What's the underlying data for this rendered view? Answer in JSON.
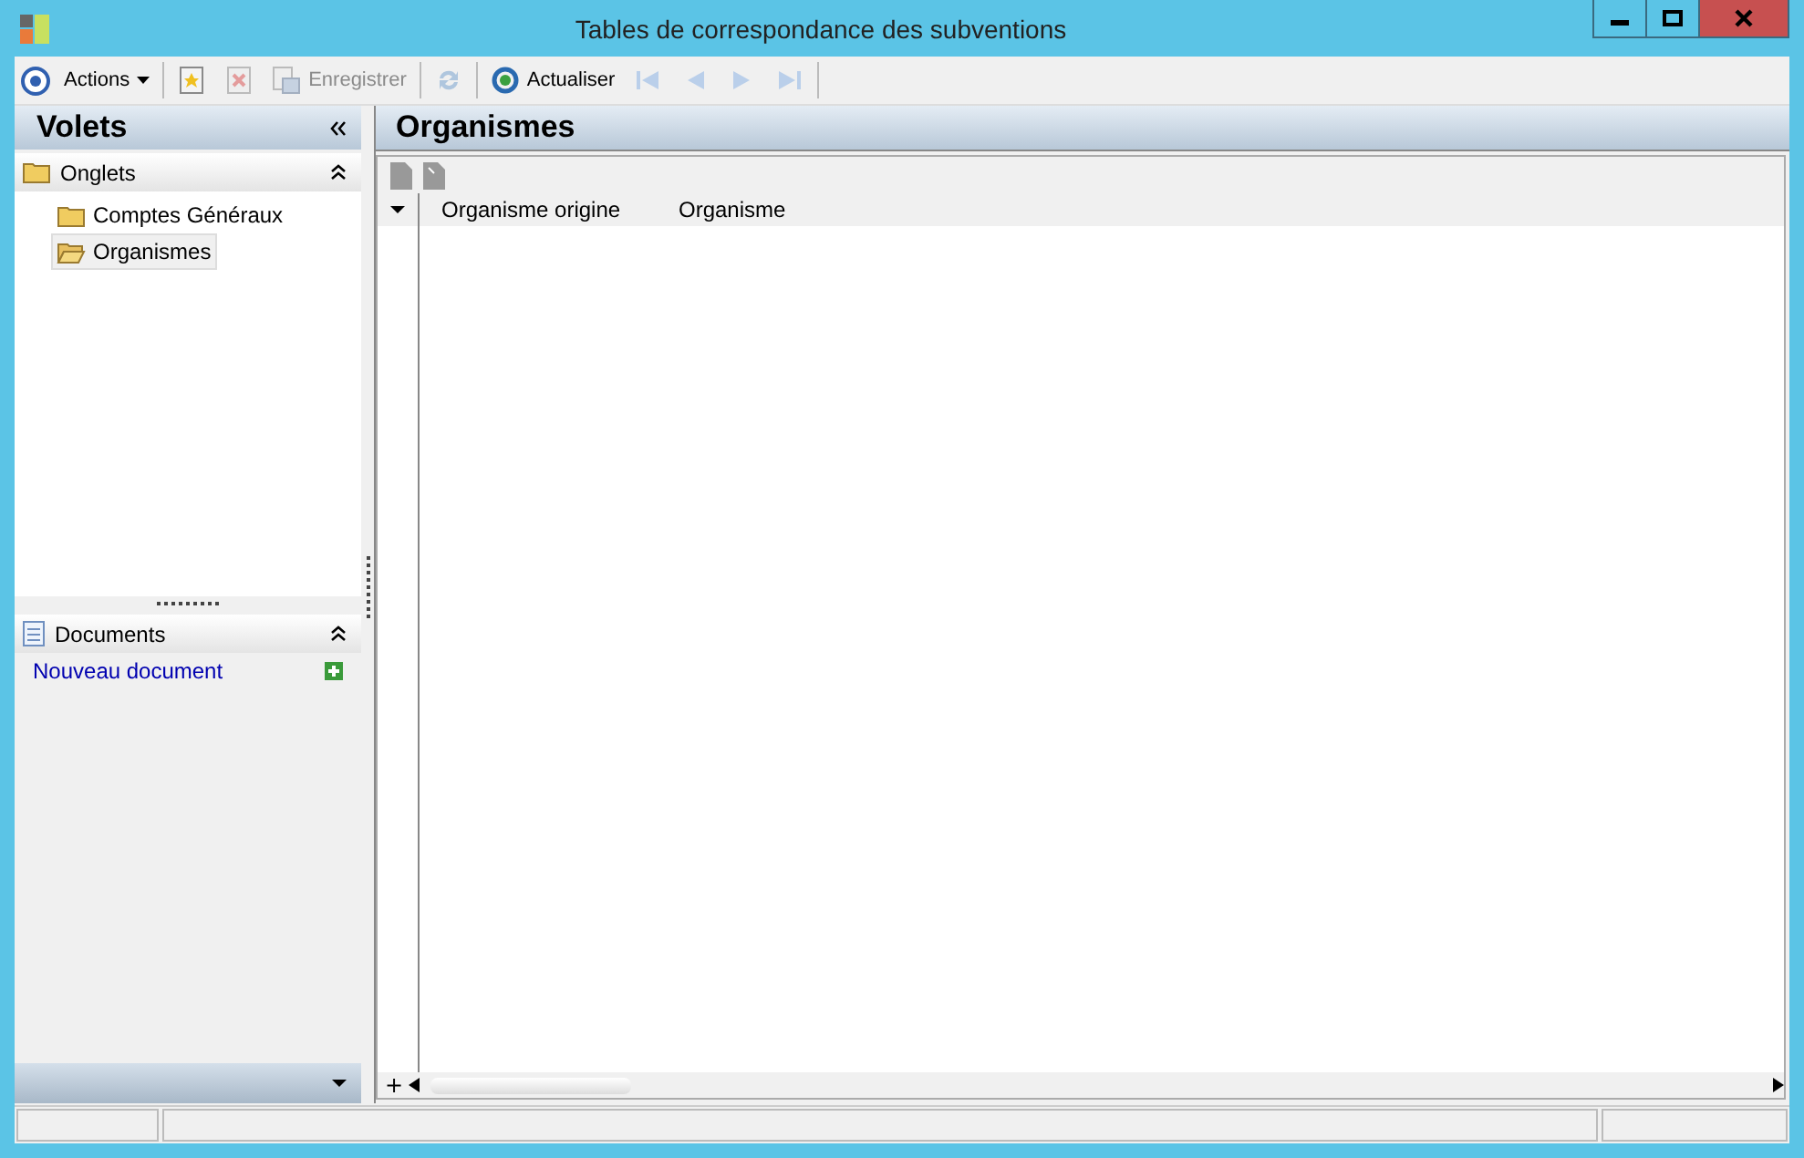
{
  "window": {
    "title": "Tables de correspondance des subventions"
  },
  "toolbar": [
    {
      "kind": "menu",
      "label": "Actions",
      "disabled": false
    },
    {
      "kind": "icon",
      "disabled": false
    },
    {
      "kind": "icon",
      "disabled": true
    },
    {
      "kind": "text",
      "label": "Enregistrer",
      "disabled": true
    },
    {
      "kind": "icon",
      "disabled": true
    },
    {
      "kind": "text",
      "label": "Actualiser",
      "disabled": false
    },
    {
      "kind": "icon",
      "disabled": true
    },
    {
      "kind": "icon",
      "disabled": true
    },
    {
      "kind": "icon",
      "disabled": true
    },
    {
      "kind": "icon",
      "disabled": true
    }
  ],
  "sidebar": {
    "title": "Volets",
    "sections": [
      {
        "title": "Onglets",
        "expanded": true,
        "items": [
          {
            "label": "Comptes Généraux",
            "selected": false
          },
          {
            "label": "Organismes",
            "selected": true
          }
        ]
      },
      {
        "title": "Documents",
        "expanded": true,
        "link": "Nouveau document"
      }
    ]
  },
  "main": {
    "title": "Organismes",
    "table": {
      "columns": [
        "Organisme origine",
        "Organisme"
      ],
      "add_label": "+"
    }
  }
}
